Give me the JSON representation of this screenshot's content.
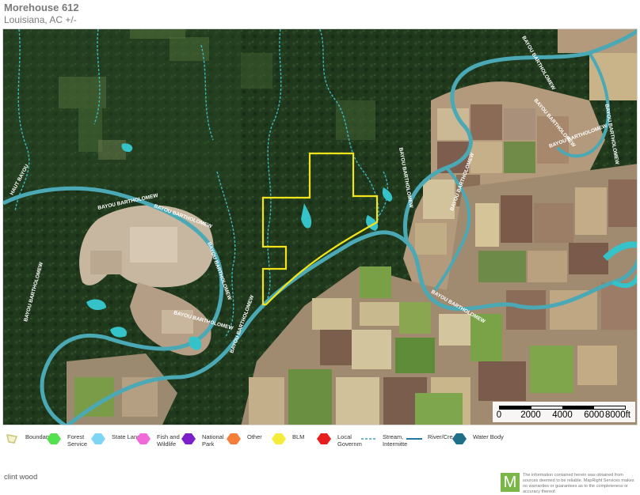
{
  "header": {
    "title": "Morehouse 612",
    "subtitle": "Louisiana,  AC +/-"
  },
  "map": {
    "river_labels": [
      "BAYOU BARTHOLOMEW",
      "BAYOU BARTHOLOMEW",
      "BAYOU BARTHOLOMEW",
      "BAYOU BARTHOLOMEW",
      "BAYOU BARTHOLOMEW",
      "BAYOU BARTHOLOMEW",
      "BAYOU BARTHOLOMEW",
      "BAYOU BARTHOLOMEW",
      "BAYOU BARTHOLOMEW",
      "BAYOU BARTHOLOMEW",
      "BAYOU BARTHOLOMEW",
      "BAYOU BARTHOLOMEW",
      "BAYOU BARTHOLOMEW"
    ],
    "hau_label": "HAUT BAYOU",
    "colors": {
      "forest": "#1f3d1d",
      "river": "#4aa9b4",
      "water": "#35c2c9",
      "boundary": "#f2e31a",
      "field_green": "#6f9e3a",
      "field_tan": "#c9b48a",
      "field_brown": "#7a5a48"
    }
  },
  "scale": {
    "labels": [
      "0",
      "2000",
      "4000",
      "6000",
      "8000ft"
    ]
  },
  "legend": [
    {
      "icon": "boundary-icon",
      "label": "Boundary",
      "color": "#c9c57a"
    },
    {
      "icon": "forest-service-icon",
      "label": "Forest Service",
      "color": "#55e04f"
    },
    {
      "icon": "state-land-icon",
      "label": "State Land",
      "color": "#7dd4f5"
    },
    {
      "icon": "fish-wildlife-icon",
      "label": "Fish and Wildlife",
      "color": "#f06ad9"
    },
    {
      "icon": "national-park-icon",
      "label": "National Park",
      "color": "#7a1fc9"
    },
    {
      "icon": "other-icon",
      "label": "Other",
      "color": "#f57f3a"
    },
    {
      "icon": "blm-icon",
      "label": "BLM",
      "color": "#f5ec3a"
    },
    {
      "icon": "local-government-icon",
      "label": "Local Governm",
      "color": "#e81e1e"
    },
    {
      "icon": "stream-icon",
      "label": "Stream, Intermitte",
      "color": "#3aa7b0"
    },
    {
      "icon": "river-creek-icon",
      "label": "River/Cre ek",
      "color": "#1e7a9e"
    },
    {
      "icon": "water-body-icon",
      "label": "Water Body",
      "color": "#1f6e8a"
    }
  ],
  "footer": {
    "owner": "clint wood",
    "logo_letter": "M",
    "disclaimer": "The information contained herein was obtained from sources deemed to be reliable. MapRight Services makes no warranties or guarantees as to the completeness or accuracy thereof."
  }
}
